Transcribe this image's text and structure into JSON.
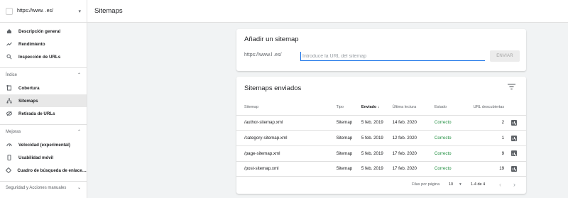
{
  "property": {
    "url": "https://www.        .es/"
  },
  "sidebar": {
    "top_items": [
      {
        "label": "Descripción general",
        "icon": "home-icon"
      },
      {
        "label": "Rendimiento",
        "icon": "trending-up-icon"
      },
      {
        "label": "Inspección de URLs",
        "icon": "search-icon"
      }
    ],
    "index_section": "Índice",
    "index_items": [
      {
        "label": "Cobertura",
        "icon": "coverage-icon"
      },
      {
        "label": "Sitemaps",
        "icon": "sitemap-icon"
      },
      {
        "label": "Retirada de URLs",
        "icon": "removal-icon"
      }
    ],
    "improve_section": "Mejoras",
    "improve_items": [
      {
        "label": "Velocidad (experimental)",
        "icon": "speed-icon"
      },
      {
        "label": "Usabilidad móvil",
        "icon": "mobile-icon"
      },
      {
        "label": "Cuadro de búsqueda de enlace…",
        "icon": "searchbox-icon"
      }
    ],
    "security_section": "Seguridad y Acciones manuales"
  },
  "header": {
    "title": "Sitemaps"
  },
  "add_sitemap": {
    "title": "Añadir un sitemap",
    "prefix": "https://www.l          .es/",
    "placeholder": "Introduce la URL del sitemap",
    "button": "ENVIAR"
  },
  "submitted": {
    "title": "Sitemaps enviados",
    "columns": {
      "sitemap": "Sitemap",
      "tipo": "Tipo",
      "enviado": "Enviado",
      "ultima": "Última lectura",
      "estado": "Estado",
      "urls": "URL descubiertas"
    },
    "rows": [
      {
        "sitemap": "/author-sitemap.xml",
        "tipo": "Sitemap",
        "enviado": "5 feb. 2019",
        "ultima": "14 feb. 2020",
        "estado": "Correcto",
        "urls": "2"
      },
      {
        "sitemap": "/category-sitemap.xml",
        "tipo": "Sitemap",
        "enviado": "5 feb. 2019",
        "ultima": "12 feb. 2020",
        "estado": "Correcto",
        "urls": "1"
      },
      {
        "sitemap": "/page-sitemap.xml",
        "tipo": "Sitemap",
        "enviado": "5 feb. 2019",
        "ultima": "17 feb. 2020",
        "estado": "Correcto",
        "urls": "9"
      },
      {
        "sitemap": "/post-sitemap.xml",
        "tipo": "Sitemap",
        "enviado": "5 feb. 2019",
        "ultima": "17 feb. 2020",
        "estado": "Correcto",
        "urls": "19"
      }
    ],
    "pagination": {
      "rows_label": "Filas por página",
      "rows_value": "10",
      "range": "1-4 de 4"
    }
  },
  "colors": {
    "accent": "#1a73e8",
    "success": "#1e8e3e",
    "active_bg": "#e8e8e8"
  }
}
